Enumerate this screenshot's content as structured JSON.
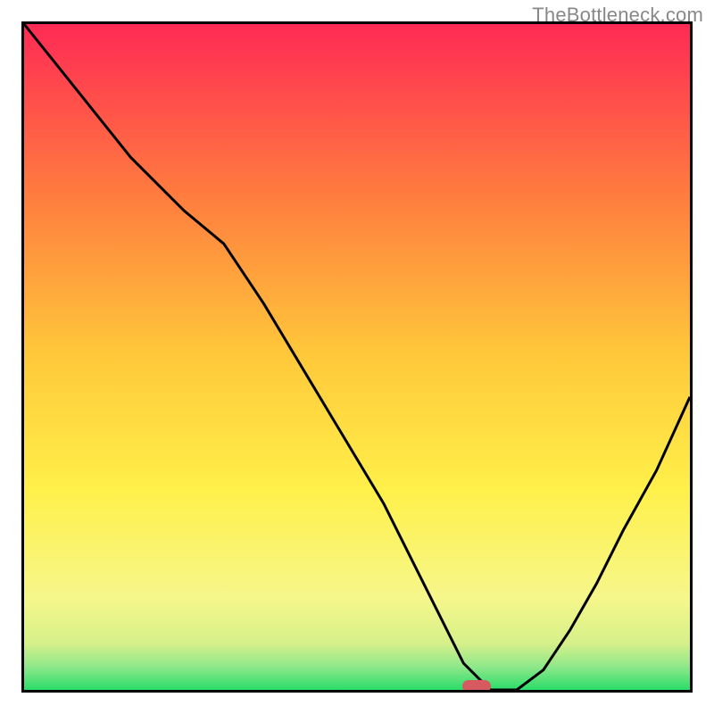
{
  "watermark": "TheBottleneck.com",
  "colors": {
    "border": "#000000",
    "curve": "#000000",
    "marker": "#d65a5f",
    "gradient_top": "#ff2a55",
    "gradient_mid1": "#ff8a3a",
    "gradient_mid2": "#ffd53a",
    "gradient_mid3": "#f7f56a",
    "gradient_bottom_band": "#eef7a0",
    "gradient_green": "#2bdc6a"
  },
  "chart_data": {
    "type": "line",
    "title": "",
    "xlabel": "",
    "ylabel": "",
    "xlim": [
      0,
      100
    ],
    "ylim": [
      0,
      100
    ],
    "grid": false,
    "legend": false,
    "series": [
      {
        "name": "bottleneck-curve",
        "x": [
          0,
          8,
          16,
          24,
          30,
          36,
          42,
          48,
          54,
          58,
          62,
          66,
          70,
          74,
          78,
          82,
          86,
          90,
          95,
          100
        ],
        "y": [
          100,
          90,
          80,
          72,
          67,
          58,
          48,
          38,
          28,
          20,
          12,
          4,
          0,
          0,
          3,
          9,
          16,
          24,
          33,
          44
        ]
      }
    ],
    "marker": {
      "x": 68,
      "y": 0
    },
    "background_gradient": {
      "stops": [
        {
          "offset": 0.0,
          "color": "#ff2a55"
        },
        {
          "offset": 0.25,
          "color": "#ff7a3f"
        },
        {
          "offset": 0.5,
          "color": "#ffc93a"
        },
        {
          "offset": 0.7,
          "color": "#fff04a"
        },
        {
          "offset": 0.86,
          "color": "#f6f78a"
        },
        {
          "offset": 0.93,
          "color": "#d7f08a"
        },
        {
          "offset": 0.965,
          "color": "#8fe88a"
        },
        {
          "offset": 1.0,
          "color": "#2bdc6a"
        }
      ]
    }
  }
}
